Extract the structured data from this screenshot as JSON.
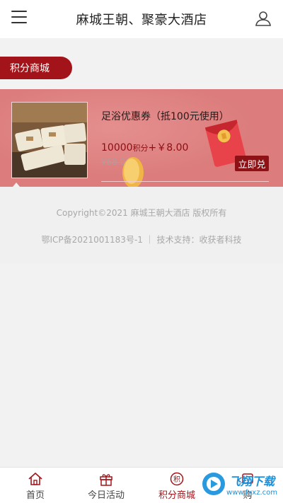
{
  "header": {
    "title": "麻城王朝、聚豪大酒店",
    "menu_icon": "hamburger-menu-icon",
    "user_icon": "user-icon"
  },
  "section": {
    "tab_label": "积分商城"
  },
  "product": {
    "name": "足浴优惠券（抵100元使用）",
    "points": "10000",
    "points_unit": "积分",
    "plus_price": "+￥8.00",
    "original_price": "¥68.00",
    "redeem_label": "立即兑"
  },
  "footer": {
    "copyright": "Copyright©2021 麻城王朝大酒店 版权所有",
    "icp": "鄂ICP备2021001183号-1 ｜ 技术支持：收获者科技"
  },
  "tabbar": {
    "items": [
      {
        "label": "首页",
        "icon": "home-icon"
      },
      {
        "label": "今日活动",
        "icon": "gift-icon"
      },
      {
        "label": "积分商城",
        "icon": "points-icon"
      },
      {
        "label": "购",
        "icon": "cart-icon"
      }
    ]
  },
  "watermark": {
    "text": "飞翔下载",
    "sub": "www.fxxz.com"
  },
  "colors": {
    "accent": "#a3141a",
    "card_bg": "#dc7c7c",
    "price": "#8e0d12"
  }
}
